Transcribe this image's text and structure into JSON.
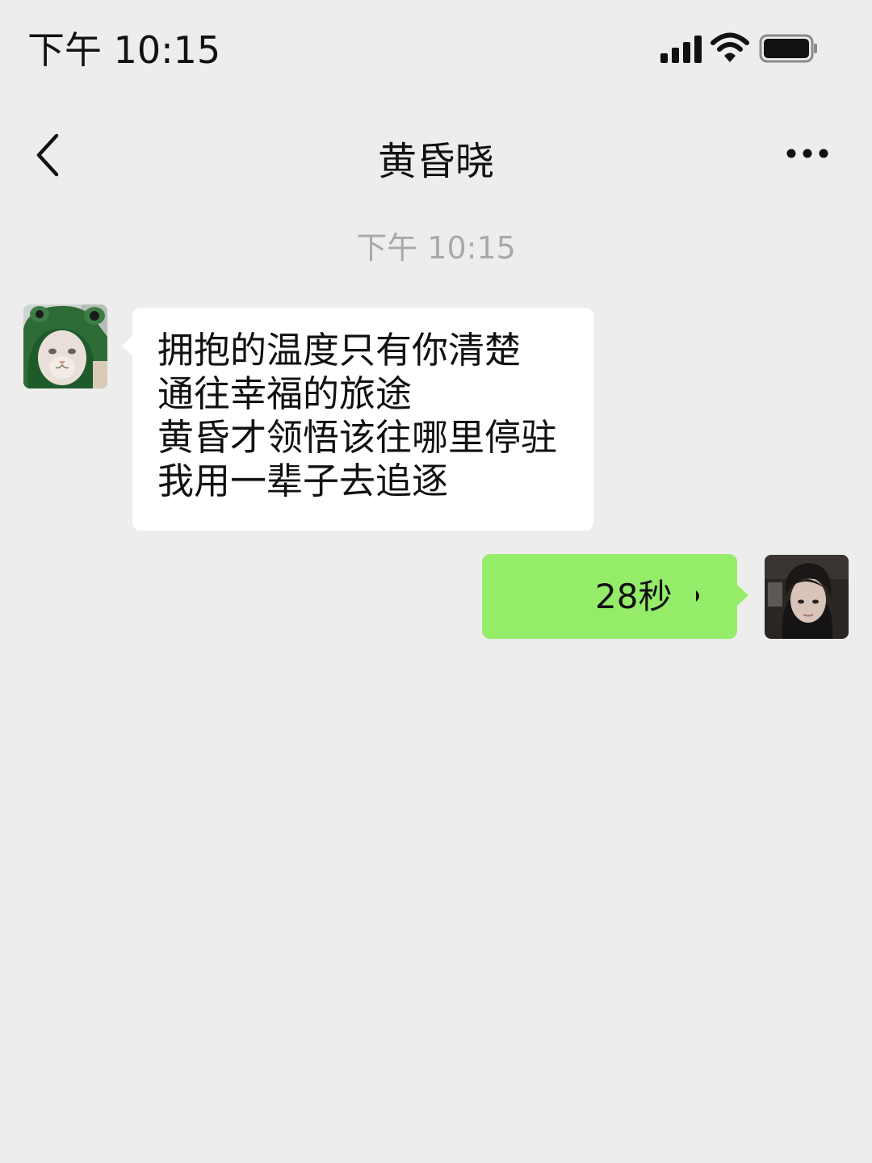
{
  "status_bar": {
    "time": "下午 10:15",
    "icons": [
      "signal-icon",
      "wifi-icon",
      "battery-icon"
    ]
  },
  "nav": {
    "title": "黄昏晓",
    "back_icon": "chevron-left-icon",
    "more_icon": "more-horizontal-icon"
  },
  "chat": {
    "timestamp": "下午 10:15",
    "messages": [
      {
        "side": "left",
        "type": "text",
        "avatar": "frog-hood-cat-avatar",
        "lines": [
          "拥抱的温度只有你清楚",
          "通往幸福的旅途",
          "黄昏才领悟该往哪里停驻",
          "我用一辈子去追逐"
        ]
      },
      {
        "side": "right",
        "type": "voice",
        "avatar": "user-portrait-avatar",
        "duration": "28秒"
      }
    ]
  },
  "colors": {
    "background": "#ededed",
    "incoming_bubble": "#ffffff",
    "outgoing_bubble": "#95ec69",
    "timestamp_text": "#a9a9a9"
  }
}
